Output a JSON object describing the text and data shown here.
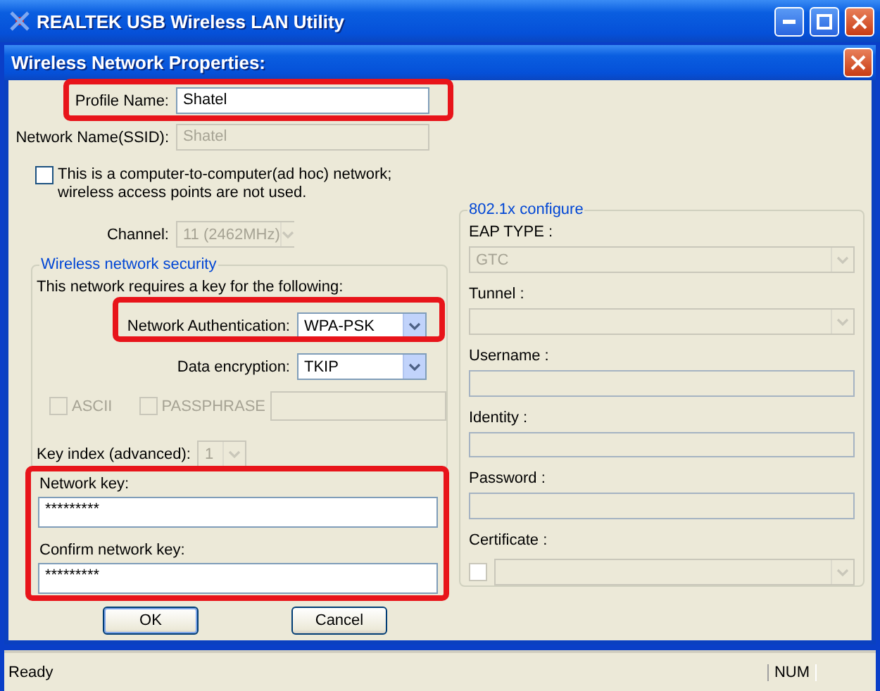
{
  "window": {
    "title": "REALTEK USB Wireless LAN Utility"
  },
  "dialog": {
    "title": "Wireless Network Properties:",
    "profile_name": {
      "label": "Profile Name:",
      "value": "Shatel"
    },
    "ssid": {
      "label": "Network Name(SSID):",
      "value": "Shatel",
      "disabled": true
    },
    "adhoc": {
      "label": "This is a computer-to-computer(ad hoc) network; wireless access points are not used.",
      "checked": false
    },
    "channel": {
      "label": "Channel:",
      "value": "11 (2462MHz)",
      "disabled": true
    },
    "security": {
      "title": "Wireless network security",
      "note": "This network requires a key for the following:",
      "authentication": {
        "label": "Network Authentication:",
        "value": "WPA-PSK"
      },
      "encryption": {
        "label": "Data encryption:",
        "value": "TKIP"
      },
      "ascii": {
        "label": "ASCII",
        "checked": false,
        "disabled": true
      },
      "passphrase": {
        "label": "PASSPHRASE",
        "checked": false,
        "disabled": true
      },
      "key_index": {
        "label": "Key index (advanced):",
        "value": "1",
        "disabled": true
      }
    },
    "network_key": {
      "label": "Network key:",
      "value": "*********"
    },
    "confirm_key": {
      "label": "Confirm network key:",
      "value": "*********"
    },
    "eap": {
      "title": "802.1x configure",
      "fields": [
        {
          "kind": "select",
          "label": "EAP TYPE :",
          "value": "GTC"
        },
        {
          "kind": "select",
          "label": "Tunnel :"
        },
        {
          "kind": "text",
          "label": "Username :"
        },
        {
          "kind": "text",
          "label": "Identity :"
        },
        {
          "kind": "text",
          "label": "Password :"
        },
        {
          "kind": "certificate",
          "label": "Certificate :",
          "checked": false
        }
      ]
    },
    "buttons": [
      {
        "label": "OK"
      },
      {
        "label": "Cancel"
      }
    ]
  },
  "status_bar": {
    "text": "Ready",
    "indicator": "NUM"
  }
}
